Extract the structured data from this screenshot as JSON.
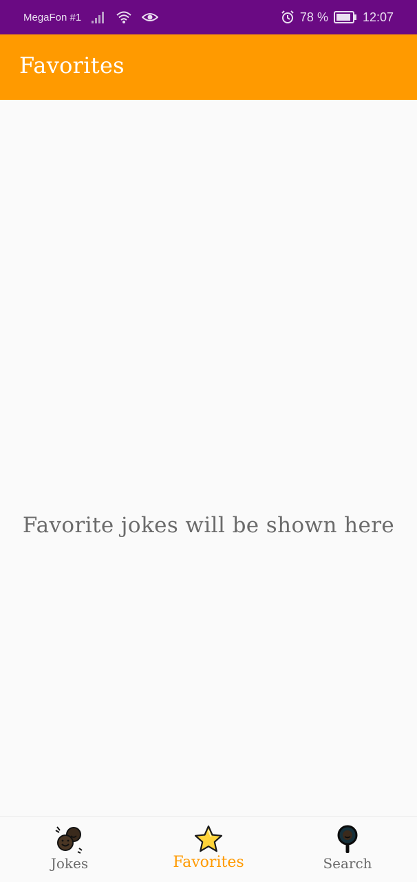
{
  "status_bar": {
    "carrier": "MegaFon #1",
    "battery_percent": "78 %",
    "time": "12:07",
    "icons": [
      "signal-icon",
      "wifi-icon",
      "eye-icon",
      "alarm-icon",
      "battery-icon"
    ]
  },
  "app_bar": {
    "title": "Favorites"
  },
  "content": {
    "empty_message": "Favorite jokes will be shown here"
  },
  "bottom_nav": {
    "items": [
      {
        "label": "Jokes",
        "icon": "laughing-faces-icon",
        "active": false
      },
      {
        "label": "Favorites",
        "icon": "star-icon",
        "active": true
      },
      {
        "label": "Search",
        "icon": "search-magnifier-icon",
        "active": false
      }
    ]
  },
  "colors": {
    "status_bar": "#6a0a83",
    "app_bar": "#ff9a00",
    "active_tab": "#ff9a00",
    "inactive_tab": "#6b6b6b",
    "background": "#fafafa"
  }
}
